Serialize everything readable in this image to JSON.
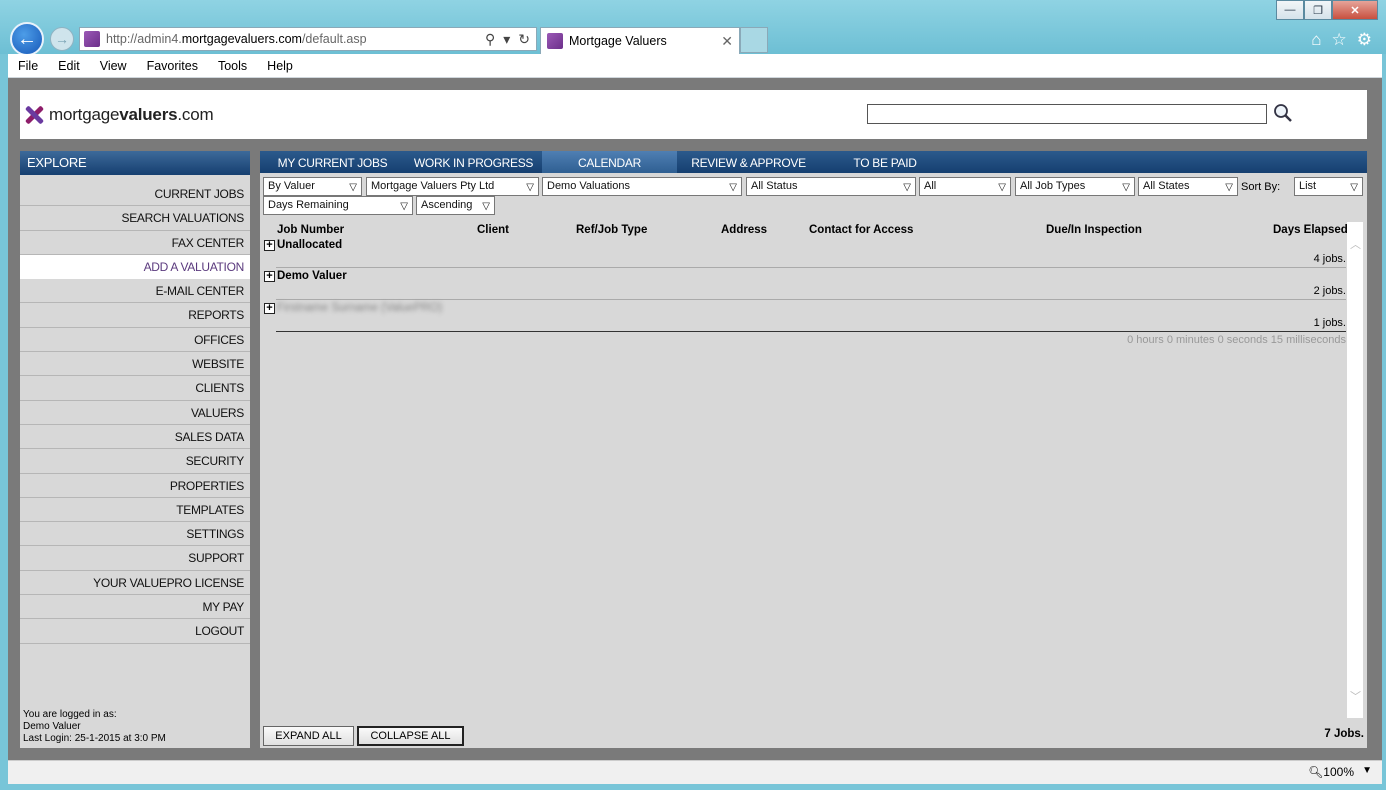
{
  "browser": {
    "url_prefix": "http://admin4.",
    "url_domain": "mortgagevaluers.com",
    "url_path": "/default.asp",
    "tab_title": "Mortgage Valuers",
    "menu": [
      "File",
      "Edit",
      "View",
      "Favorites",
      "Tools",
      "Help"
    ],
    "zoom": "100%"
  },
  "site": {
    "logo_plain": "mortgage",
    "logo_bold": "valuers",
    "logo_suffix": ".com"
  },
  "sidebar": {
    "heading": "EXPLORE",
    "items": [
      "CURRENT JOBS",
      "SEARCH VALUATIONS",
      "FAX CENTER",
      "ADD A VALUATION",
      "E-MAIL CENTER",
      "REPORTS",
      "OFFICES",
      "WEBSITE",
      "CLIENTS",
      "VALUERS",
      "SALES DATA",
      "SECURITY",
      "PROPERTIES",
      "TEMPLATES",
      "SETTINGS",
      "SUPPORT",
      "YOUR VALUEPRO LICENSE",
      "MY PAY",
      "LOGOUT"
    ],
    "active_item": "ADD A VALUATION",
    "login_label": "You are logged in as:",
    "login_user": "Demo Valuer",
    "last_login": "Last Login: 25-1-2015 at 3:0 PM"
  },
  "tabs": [
    "MY CURRENT JOBS",
    "WORK IN PROGRESS",
    "CALENDAR",
    "REVIEW & APPROVE",
    "TO BE PAID"
  ],
  "active_tab": "CALENDAR",
  "filters": {
    "group_by": "By Valuer",
    "company": "Mortgage Valuers Pty Ltd",
    "valuations": "Demo Valuations",
    "status": "All Status",
    "all": "All",
    "job_types": "All Job Types",
    "states": "All States",
    "sort_label": "Sort By:",
    "view": "List",
    "sort_field": "Days Remaining",
    "sort_order": "Ascending"
  },
  "columns": [
    "Job Number",
    "Client",
    "Ref/Job Type",
    "Address",
    "Contact for Access",
    "Due/In Inspection",
    "Days Elapsed"
  ],
  "groups": [
    {
      "name": "Unallocated",
      "jobs": "4 jobs."
    },
    {
      "name": "Demo Valuer",
      "jobs": "2 jobs."
    },
    {
      "name": "Firstname Surname (ValuePRO)",
      "jobs": "1 jobs."
    }
  ],
  "timing": "0 hours 0 minutes 0 seconds 15 milliseconds",
  "buttons": {
    "expand": "EXPAND ALL",
    "collapse": "COLLAPSE ALL"
  },
  "total": "7 Jobs."
}
